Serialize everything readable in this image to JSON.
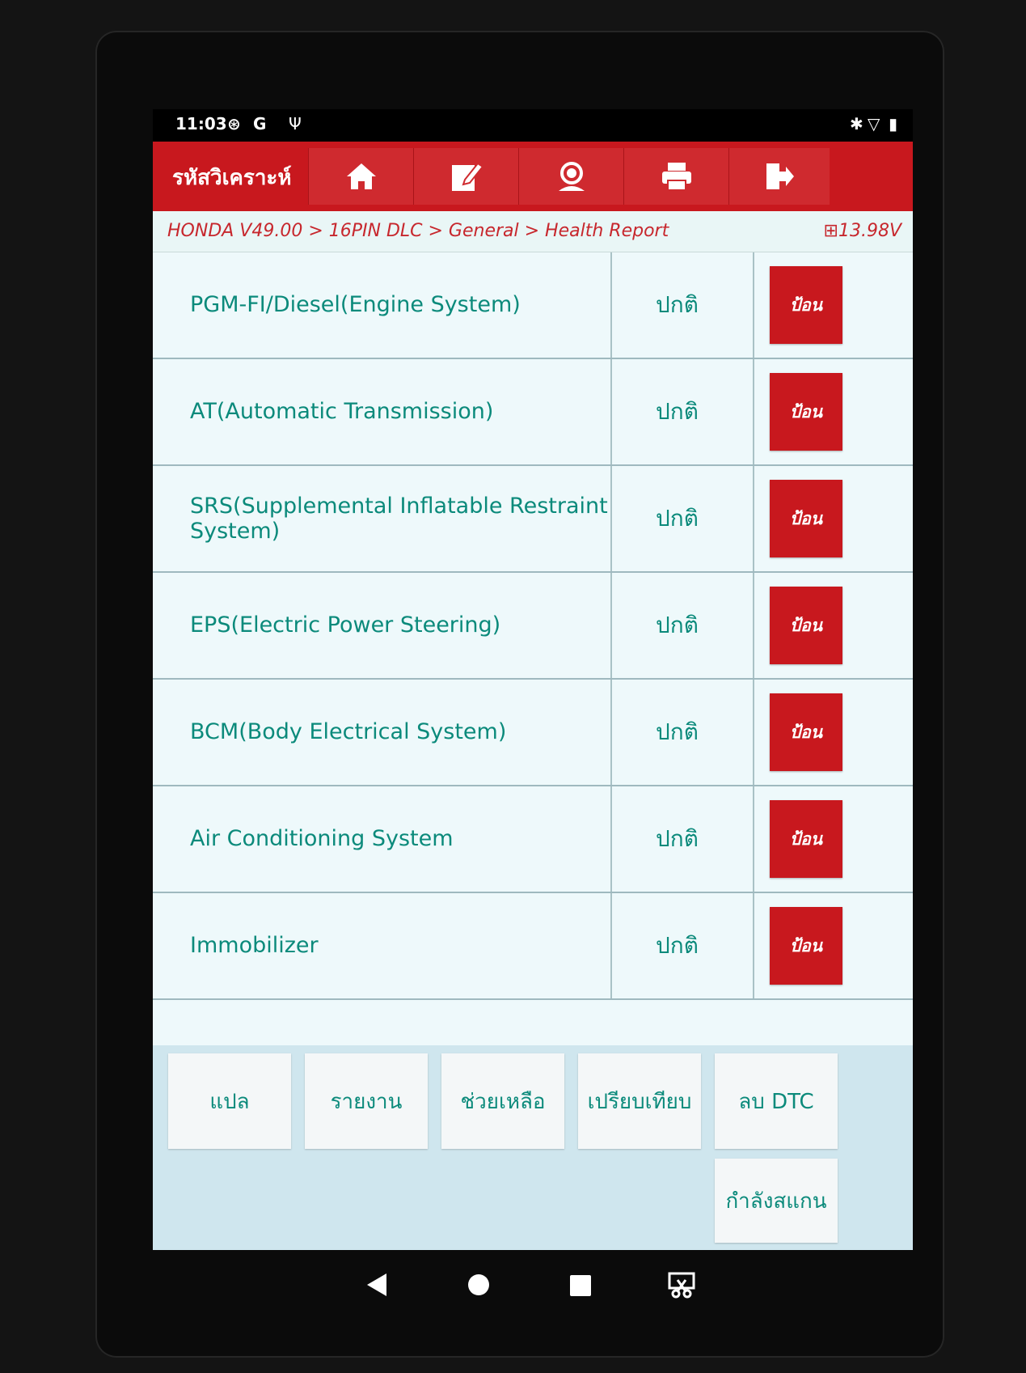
{
  "status_bar": {
    "time": "11:03",
    "icons": [
      "activity-icon",
      "google-icon",
      "usb-icon",
      "bluetooth-icon",
      "wifi-icon",
      "battery-icon"
    ]
  },
  "app_bar": {
    "title": "รหัสวิเคราะห์",
    "buttons": [
      "home-icon",
      "edit-icon",
      "support-icon",
      "print-icon",
      "exit-icon"
    ]
  },
  "breadcrumb": {
    "path": "HONDA V49.00 > 16PIN DLC > General > Health Report",
    "voltage": "13.98V"
  },
  "systems": [
    {
      "name": "PGM-FI/Diesel(Engine System)",
      "status": "ปกติ",
      "action": "ป้อน"
    },
    {
      "name": "AT(Automatic Transmission)",
      "status": "ปกติ",
      "action": "ป้อน"
    },
    {
      "name": "SRS(Supplemental Inflatable Restraint System)",
      "status": "ปกติ",
      "action": "ป้อน"
    },
    {
      "name": "EPS(Electric Power Steering)",
      "status": "ปกติ",
      "action": "ป้อน"
    },
    {
      "name": "BCM(Body Electrical System)",
      "status": "ปกติ",
      "action": "ป้อน"
    },
    {
      "name": "Air Conditioning System",
      "status": "ปกติ",
      "action": "ป้อน"
    },
    {
      "name": "Immobilizer",
      "status": "ปกติ",
      "action": "ป้อน"
    }
  ],
  "actions": {
    "translate": "แปล",
    "report": "รายงาน",
    "help": "ช่วยเหลือ",
    "compare": "เปรียบเทียบ",
    "clear_dtc": "ลบ DTC",
    "scanning": "กำลังสแกน"
  },
  "colors": {
    "accent_red": "#c8181e",
    "text_teal": "#0b8a7b",
    "list_bg": "#eef9fb"
  }
}
